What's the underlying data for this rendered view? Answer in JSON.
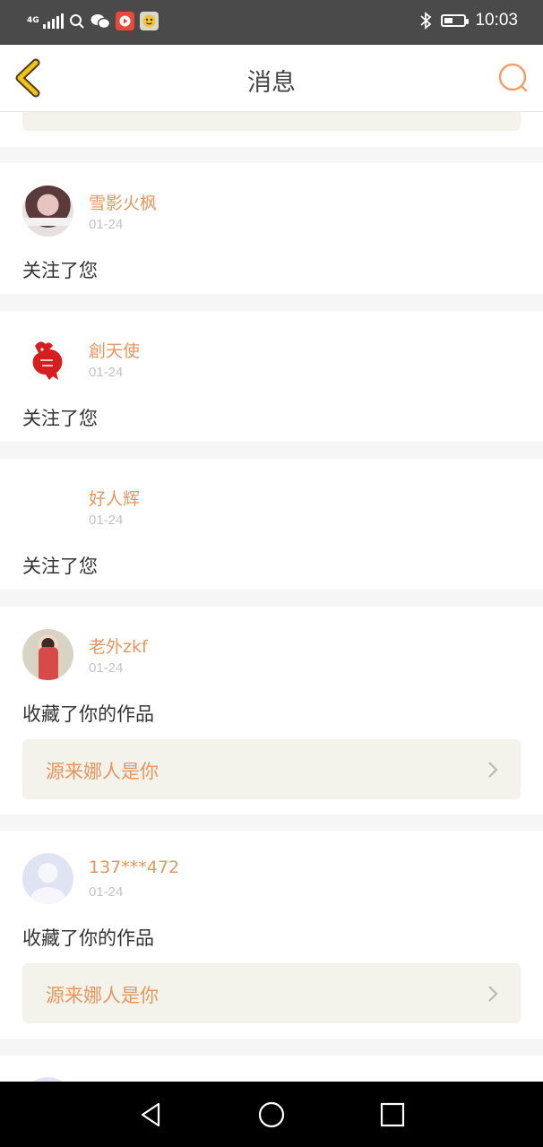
{
  "status_bar": {
    "network": "4G",
    "time": "10:03",
    "icons": [
      "signal-icon",
      "search-icon",
      "wechat-icon",
      "video-app-icon",
      "face-app-icon",
      "bluetooth-icon",
      "battery-icon"
    ]
  },
  "header": {
    "title": "消息",
    "back_icon": "chevron-left-icon",
    "search_icon": "search-icon",
    "accent_color": "#e6965e"
  },
  "messages": [
    {
      "username": "雪影火枫",
      "date": "01-24",
      "action": "关注了您",
      "avatar": "photo-avatar"
    },
    {
      "username": "創天使",
      "date": "01-24",
      "action": "关注了您",
      "avatar": "red-rooster-papercut-avatar"
    },
    {
      "username": "好人辉",
      "date": "01-24",
      "action": "关注了您",
      "avatar": "blank-avatar"
    },
    {
      "username": "老外zkf",
      "date": "01-24",
      "action": "收藏了你的作品",
      "work_title": "源来娜人是你",
      "avatar": "photo-avatar"
    },
    {
      "username": "137***472",
      "date": "01-24",
      "action": "收藏了你的作品",
      "work_title": "源来娜人是你",
      "avatar": "default-user-avatar"
    }
  ],
  "nav_bar": {
    "icons": [
      "back-triangle-icon",
      "home-circle-icon",
      "recents-square-icon"
    ]
  }
}
